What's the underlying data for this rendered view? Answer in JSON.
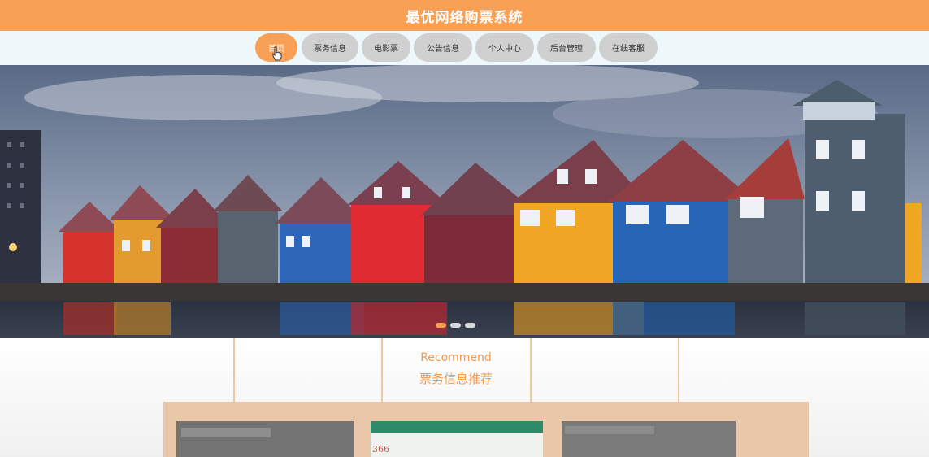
{
  "header": {
    "title": "最优网络购票系统"
  },
  "nav": {
    "items": [
      {
        "label": "首页",
        "active": true
      },
      {
        "label": "票务信息"
      },
      {
        "label": "电影票"
      },
      {
        "label": "公告信息"
      },
      {
        "label": "个人中心"
      },
      {
        "label": "后台管理"
      },
      {
        "label": "在线客服"
      }
    ]
  },
  "banner": {
    "dots": 3,
    "active_dot": 0
  },
  "recommend": {
    "title_en": "Recommend",
    "title_zh": "票务信息推荐"
  },
  "cards": [
    {
      "text": ""
    },
    {
      "text": "366"
    },
    {
      "text": ""
    }
  ],
  "colors": {
    "accent": "#f7a056",
    "nav_bg": "#eef7fa",
    "pill": "#d0d0d0"
  }
}
